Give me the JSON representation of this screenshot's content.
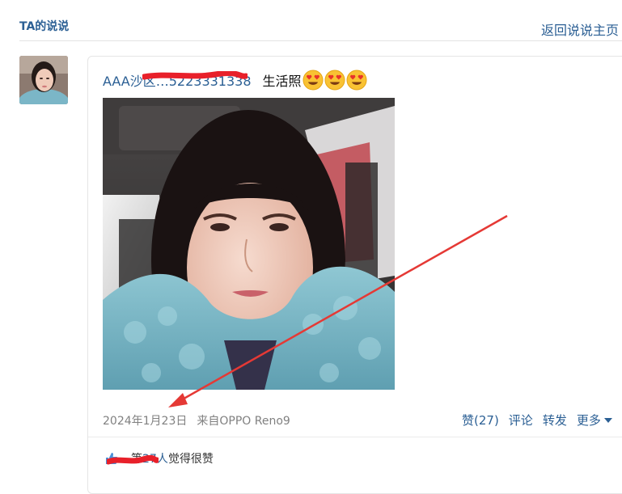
{
  "header": {
    "title": "TA的说说",
    "back_link": "返回说说主页"
  },
  "post": {
    "author": "AAA沙区…5223331338",
    "text": "生活照",
    "emoji": [
      "smiling-face-with-heart-eyes",
      "smiling-face-with-heart-eyes",
      "smiling-face-with-heart-eyes"
    ],
    "date": "2024年1月23日",
    "source": "来自OPPO Reno9",
    "actions": {
      "like": "赞(27)",
      "comment": "评论",
      "share": "转发",
      "more": "更多"
    },
    "likes": {
      "likers": "…",
      "connector": "等",
      "count": "27人",
      "suffix": "觉得很赞"
    }
  },
  "colors": {
    "link": "#2b5f94",
    "meta": "#808080",
    "annotation_arrow": "#e53935",
    "redaction": "#e8202a"
  }
}
